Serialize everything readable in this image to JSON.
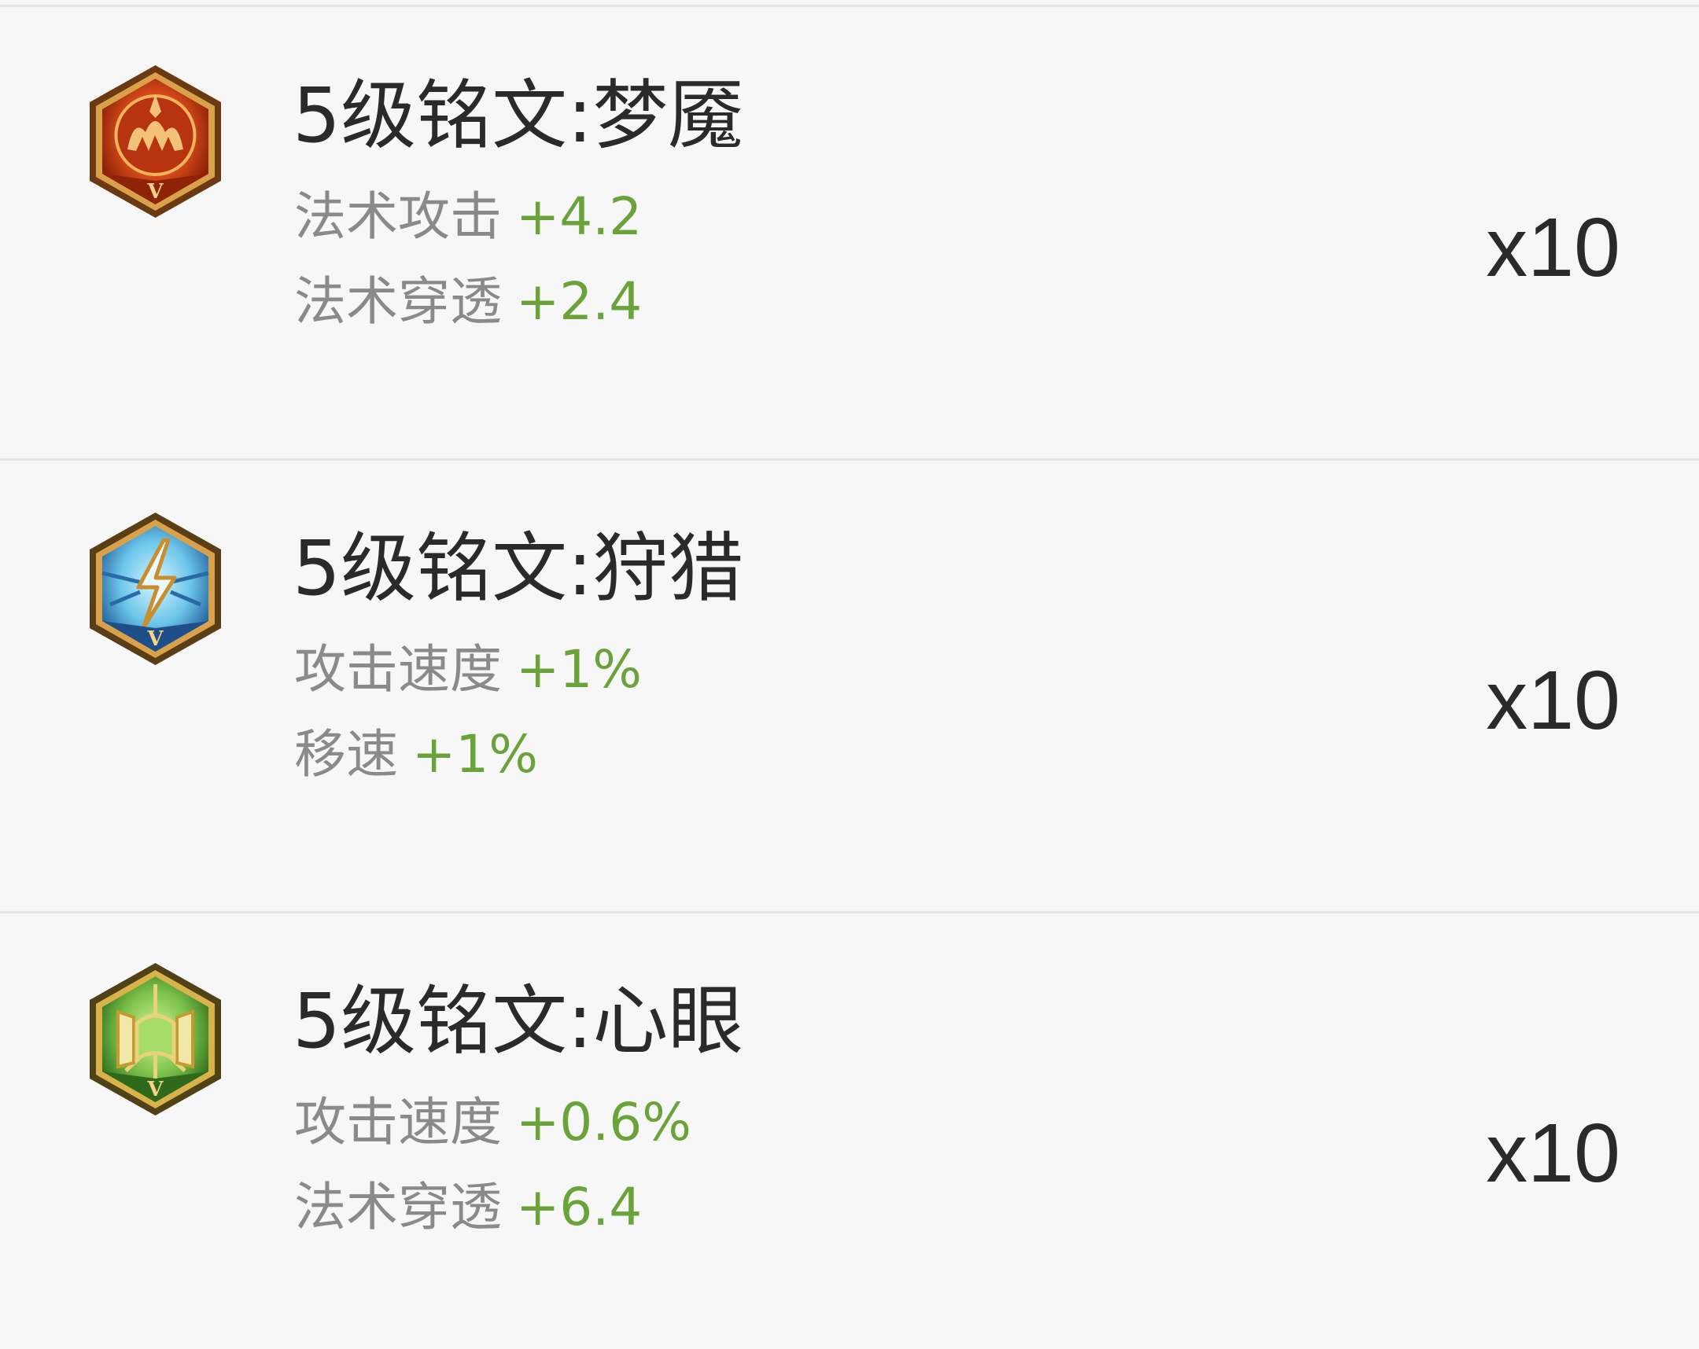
{
  "inscriptions": [
    {
      "title": "5级铭文:梦魇",
      "badge_icon": "nightmare-inscription-icon",
      "badge_color": "#d84a1a",
      "stats": [
        {
          "name": "法术攻击",
          "value": "+4.2"
        },
        {
          "name": "法术穿透",
          "value": "+2.4"
        }
      ],
      "count": "x10"
    },
    {
      "title": "5级铭文:狩猎",
      "badge_icon": "hunt-inscription-icon",
      "badge_color": "#3a9fd0",
      "stats": [
        {
          "name": "攻击速度",
          "value": "+1%"
        },
        {
          "name": "移速",
          "value": "+1%"
        }
      ],
      "count": "x10"
    },
    {
      "title": "5级铭文:心眼",
      "badge_icon": "mind-eye-inscription-icon",
      "badge_color": "#6fb23a",
      "stats": [
        {
          "name": "攻击速度",
          "value": "+0.6%"
        },
        {
          "name": "法术穿透",
          "value": "+6.4"
        }
      ],
      "count": "x10"
    }
  ],
  "colors": {
    "stat_value_green": "#6aa33a",
    "stat_name_gray": "#8a8a8a",
    "title_dark": "#2a2a2a"
  }
}
